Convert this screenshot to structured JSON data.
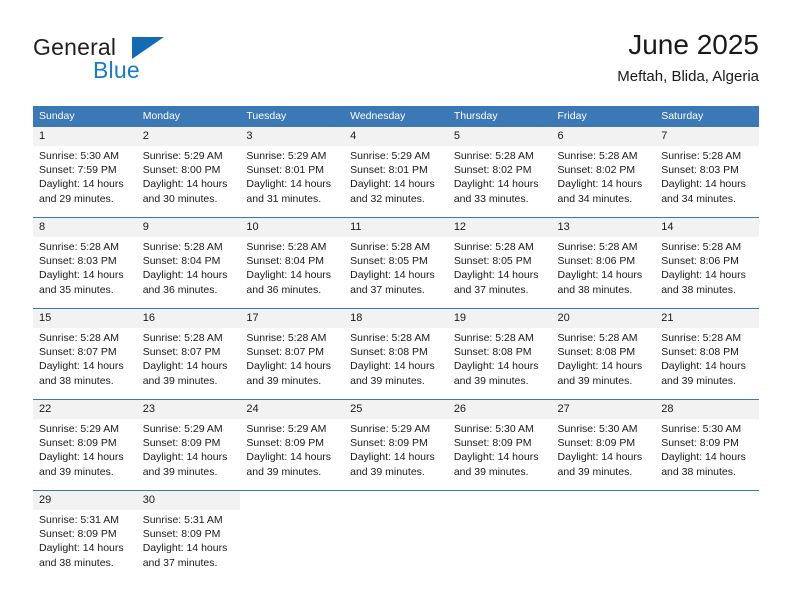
{
  "logo": {
    "word_one": "General",
    "word_two": "Blue",
    "triangle_color": "#136cb2",
    "blue_text_color": "#1a7cc4"
  },
  "header": {
    "title": "June 2025",
    "subtitle": "Meftah, Blida, Algeria"
  },
  "theme": {
    "header_bar_color": "#3b78b5",
    "row_band_color": "#f2f2f2",
    "grid_line_color": "#3b78b5",
    "text_color": "#1a1a1a"
  },
  "weekday_headers": [
    "Sunday",
    "Monday",
    "Tuesday",
    "Wednesday",
    "Thursday",
    "Friday",
    "Saturday"
  ],
  "labels": {
    "sunrise_prefix": "Sunrise:",
    "sunset_prefix": "Sunset:",
    "daylight_prefix": "Daylight:"
  },
  "weeks": [
    [
      {
        "day": "1",
        "sunrise": "Sunrise: 5:30 AM",
        "sunset": "Sunset: 7:59 PM",
        "daylight": "Daylight: 14 hours and 29 minutes."
      },
      {
        "day": "2",
        "sunrise": "Sunrise: 5:29 AM",
        "sunset": "Sunset: 8:00 PM",
        "daylight": "Daylight: 14 hours and 30 minutes."
      },
      {
        "day": "3",
        "sunrise": "Sunrise: 5:29 AM",
        "sunset": "Sunset: 8:01 PM",
        "daylight": "Daylight: 14 hours and 31 minutes."
      },
      {
        "day": "4",
        "sunrise": "Sunrise: 5:29 AM",
        "sunset": "Sunset: 8:01 PM",
        "daylight": "Daylight: 14 hours and 32 minutes."
      },
      {
        "day": "5",
        "sunrise": "Sunrise: 5:28 AM",
        "sunset": "Sunset: 8:02 PM",
        "daylight": "Daylight: 14 hours and 33 minutes."
      },
      {
        "day": "6",
        "sunrise": "Sunrise: 5:28 AM",
        "sunset": "Sunset: 8:02 PM",
        "daylight": "Daylight: 14 hours and 34 minutes."
      },
      {
        "day": "7",
        "sunrise": "Sunrise: 5:28 AM",
        "sunset": "Sunset: 8:03 PM",
        "daylight": "Daylight: 14 hours and 34 minutes."
      }
    ],
    [
      {
        "day": "8",
        "sunrise": "Sunrise: 5:28 AM",
        "sunset": "Sunset: 8:03 PM",
        "daylight": "Daylight: 14 hours and 35 minutes."
      },
      {
        "day": "9",
        "sunrise": "Sunrise: 5:28 AM",
        "sunset": "Sunset: 8:04 PM",
        "daylight": "Daylight: 14 hours and 36 minutes."
      },
      {
        "day": "10",
        "sunrise": "Sunrise: 5:28 AM",
        "sunset": "Sunset: 8:04 PM",
        "daylight": "Daylight: 14 hours and 36 minutes."
      },
      {
        "day": "11",
        "sunrise": "Sunrise: 5:28 AM",
        "sunset": "Sunset: 8:05 PM",
        "daylight": "Daylight: 14 hours and 37 minutes."
      },
      {
        "day": "12",
        "sunrise": "Sunrise: 5:28 AM",
        "sunset": "Sunset: 8:05 PM",
        "daylight": "Daylight: 14 hours and 37 minutes."
      },
      {
        "day": "13",
        "sunrise": "Sunrise: 5:28 AM",
        "sunset": "Sunset: 8:06 PM",
        "daylight": "Daylight: 14 hours and 38 minutes."
      },
      {
        "day": "14",
        "sunrise": "Sunrise: 5:28 AM",
        "sunset": "Sunset: 8:06 PM",
        "daylight": "Daylight: 14 hours and 38 minutes."
      }
    ],
    [
      {
        "day": "15",
        "sunrise": "Sunrise: 5:28 AM",
        "sunset": "Sunset: 8:07 PM",
        "daylight": "Daylight: 14 hours and 38 minutes."
      },
      {
        "day": "16",
        "sunrise": "Sunrise: 5:28 AM",
        "sunset": "Sunset: 8:07 PM",
        "daylight": "Daylight: 14 hours and 39 minutes."
      },
      {
        "day": "17",
        "sunrise": "Sunrise: 5:28 AM",
        "sunset": "Sunset: 8:07 PM",
        "daylight": "Daylight: 14 hours and 39 minutes."
      },
      {
        "day": "18",
        "sunrise": "Sunrise: 5:28 AM",
        "sunset": "Sunset: 8:08 PM",
        "daylight": "Daylight: 14 hours and 39 minutes."
      },
      {
        "day": "19",
        "sunrise": "Sunrise: 5:28 AM",
        "sunset": "Sunset: 8:08 PM",
        "daylight": "Daylight: 14 hours and 39 minutes."
      },
      {
        "day": "20",
        "sunrise": "Sunrise: 5:28 AM",
        "sunset": "Sunset: 8:08 PM",
        "daylight": "Daylight: 14 hours and 39 minutes."
      },
      {
        "day": "21",
        "sunrise": "Sunrise: 5:28 AM",
        "sunset": "Sunset: 8:08 PM",
        "daylight": "Daylight: 14 hours and 39 minutes."
      }
    ],
    [
      {
        "day": "22",
        "sunrise": "Sunrise: 5:29 AM",
        "sunset": "Sunset: 8:09 PM",
        "daylight": "Daylight: 14 hours and 39 minutes."
      },
      {
        "day": "23",
        "sunrise": "Sunrise: 5:29 AM",
        "sunset": "Sunset: 8:09 PM",
        "daylight": "Daylight: 14 hours and 39 minutes."
      },
      {
        "day": "24",
        "sunrise": "Sunrise: 5:29 AM",
        "sunset": "Sunset: 8:09 PM",
        "daylight": "Daylight: 14 hours and 39 minutes."
      },
      {
        "day": "25",
        "sunrise": "Sunrise: 5:29 AM",
        "sunset": "Sunset: 8:09 PM",
        "daylight": "Daylight: 14 hours and 39 minutes."
      },
      {
        "day": "26",
        "sunrise": "Sunrise: 5:30 AM",
        "sunset": "Sunset: 8:09 PM",
        "daylight": "Daylight: 14 hours and 39 minutes."
      },
      {
        "day": "27",
        "sunrise": "Sunrise: 5:30 AM",
        "sunset": "Sunset: 8:09 PM",
        "daylight": "Daylight: 14 hours and 39 minutes."
      },
      {
        "day": "28",
        "sunrise": "Sunrise: 5:30 AM",
        "sunset": "Sunset: 8:09 PM",
        "daylight": "Daylight: 14 hours and 38 minutes."
      }
    ],
    [
      {
        "day": "29",
        "sunrise": "Sunrise: 5:31 AM",
        "sunset": "Sunset: 8:09 PM",
        "daylight": "Daylight: 14 hours and 38 minutes."
      },
      {
        "day": "30",
        "sunrise": "Sunrise: 5:31 AM",
        "sunset": "Sunset: 8:09 PM",
        "daylight": "Daylight: 14 hours and 37 minutes."
      },
      null,
      null,
      null,
      null,
      null
    ]
  ]
}
